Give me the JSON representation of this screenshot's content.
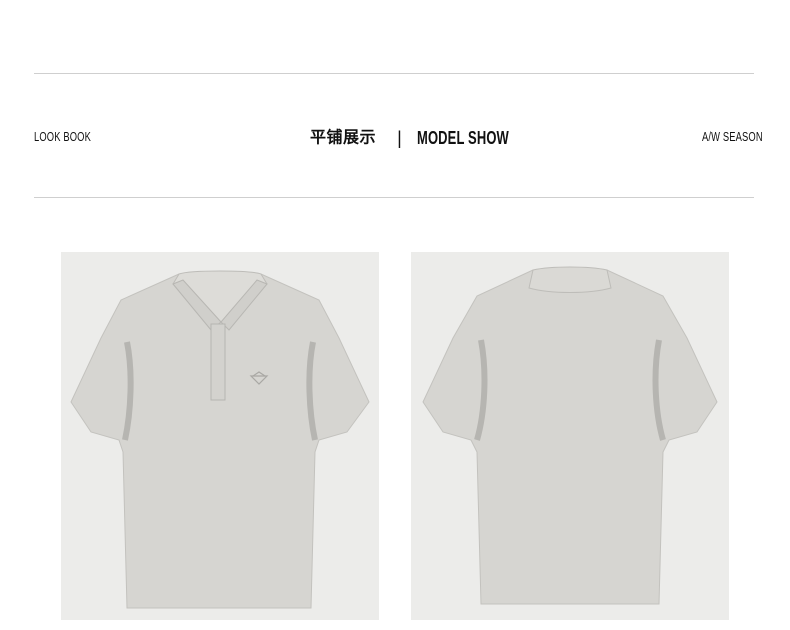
{
  "header": {
    "left_label": "LOOK BOOK",
    "center_cn": "平铺展示",
    "separator": "|",
    "center_en": "MODEL SHOW",
    "right_label": "A/W SEASON"
  },
  "products": [
    {
      "view": "front",
      "color": "#d6d5d1"
    },
    {
      "view": "back",
      "color": "#d6d5d1"
    }
  ],
  "colors": {
    "background": "#ffffff",
    "panel": "#ececea",
    "rule": "#cfcfcf",
    "shirt": "#d6d5d1",
    "shadow": "#9c9b97"
  }
}
